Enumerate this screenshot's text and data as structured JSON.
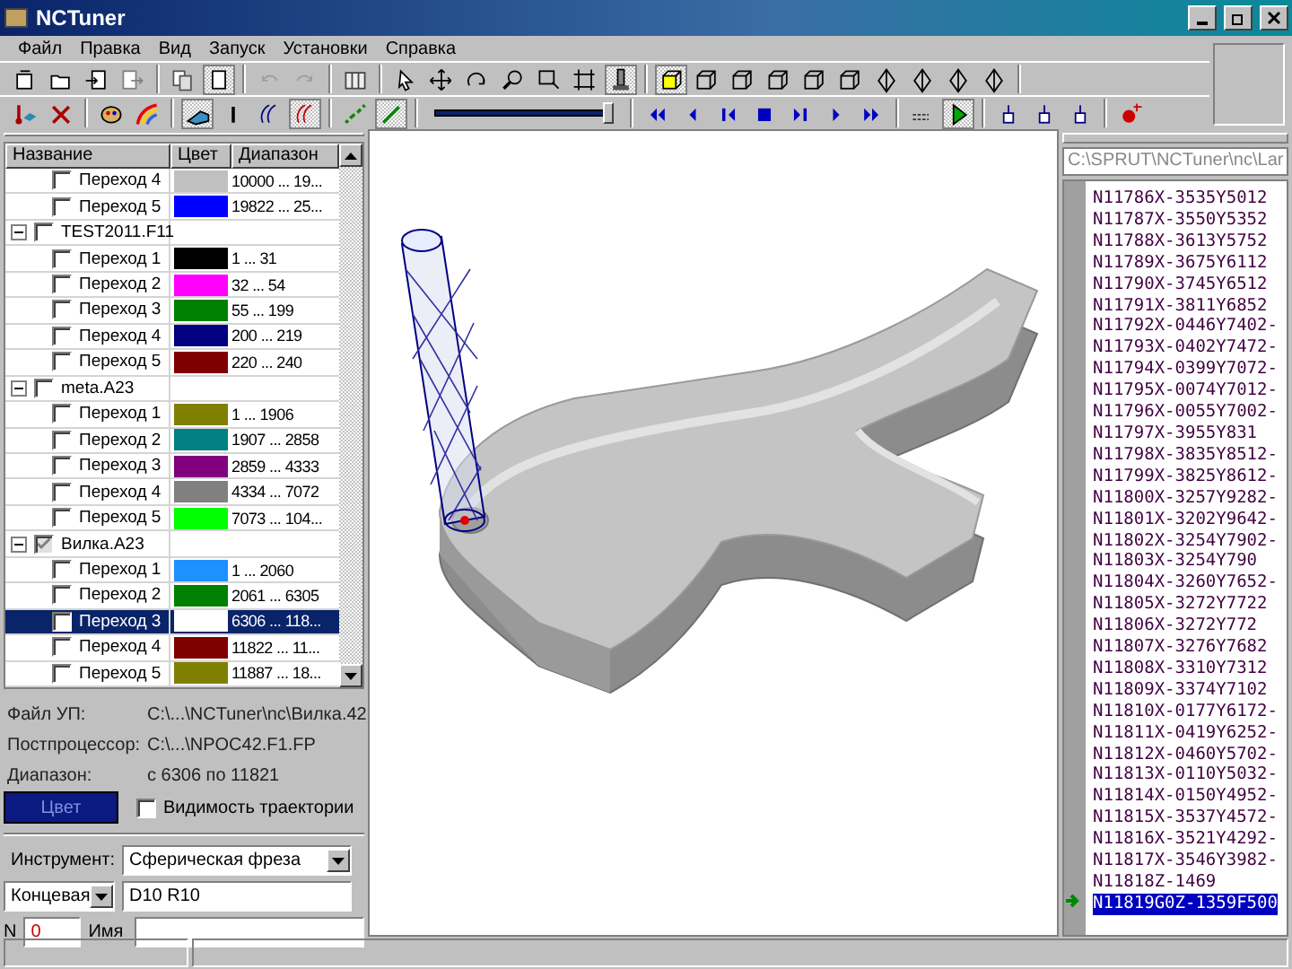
{
  "window": {
    "title": "NCTuner"
  },
  "menu": [
    "Файл",
    "Правка",
    "Вид",
    "Запуск",
    "Установки",
    "Справка"
  ],
  "toolbars": [
    [
      {
        "kind": "doc",
        "pressed": false,
        "disabled": false
      },
      {
        "kind": "folder",
        "pressed": false,
        "disabled": false
      },
      {
        "kind": "import",
        "pressed": false,
        "disabled": false
      },
      {
        "kind": "export",
        "pressed": false,
        "disabled": false
      },
      {
        "kind": "sep"
      },
      {
        "kind": "copy",
        "pressed": false,
        "disabled": false
      },
      {
        "kind": "page",
        "pressed": true,
        "disabled": false
      },
      {
        "kind": "sep"
      },
      {
        "kind": "undo",
        "pressed": false,
        "disabled": true
      },
      {
        "kind": "redo",
        "pressed": false,
        "disabled": true
      },
      {
        "kind": "sep"
      },
      {
        "kind": "grid",
        "pressed": false,
        "disabled": false
      },
      {
        "kind": "sep"
      },
      {
        "kind": "cursor",
        "pressed": false,
        "disabled": false
      },
      {
        "kind": "move",
        "pressed": false,
        "disabled": false
      },
      {
        "kind": "rotate",
        "pressed": false,
        "disabled": false
      },
      {
        "kind": "zoom",
        "pressed": false,
        "disabled": false
      },
      {
        "kind": "zoomrect",
        "pressed": false,
        "disabled": false
      },
      {
        "kind": "fit",
        "pressed": false,
        "disabled": false
      },
      {
        "kind": "cutter",
        "pressed": true,
        "disabled": false
      },
      {
        "kind": "sep"
      },
      {
        "kind": "cubeyellow",
        "pressed": true,
        "disabled": false
      },
      {
        "kind": "cube",
        "pressed": false,
        "disabled": false
      },
      {
        "kind": "cube",
        "pressed": false,
        "disabled": false
      },
      {
        "kind": "cube",
        "pressed": false,
        "disabled": false
      },
      {
        "kind": "cube",
        "pressed": false,
        "disabled": false
      },
      {
        "kind": "cube",
        "pressed": false,
        "disabled": false
      },
      {
        "kind": "diamond",
        "pressed": false,
        "disabled": false
      },
      {
        "kind": "diamond",
        "pressed": false,
        "disabled": false
      },
      {
        "kind": "diamond",
        "pressed": false,
        "disabled": false
      },
      {
        "kind": "diamond",
        "pressed": false,
        "disabled": false
      },
      {
        "kind": "sep"
      }
    ],
    [
      {
        "kind": "thermo",
        "pressed": false,
        "disabled": false
      },
      {
        "kind": "cross",
        "pressed": false,
        "disabled": false
      },
      {
        "kind": "sep"
      },
      {
        "kind": "palette",
        "pressed": false,
        "disabled": false
      },
      {
        "kind": "rainbow",
        "pressed": false,
        "disabled": false
      },
      {
        "kind": "sep"
      },
      {
        "kind": "solid",
        "pressed": true,
        "disabled": false
      },
      {
        "kind": "bar",
        "pressed": false,
        "disabled": false
      },
      {
        "kind": "wave",
        "pressed": false,
        "disabled": false
      },
      {
        "kind": "wavered",
        "pressed": true,
        "disabled": false
      },
      {
        "kind": "sep"
      },
      {
        "kind": "arrows",
        "pressed": false,
        "disabled": false
      },
      {
        "kind": "pencil",
        "pressed": true,
        "disabled": false
      },
      {
        "kind": "sep"
      },
      {
        "kind": "slider"
      },
      {
        "kind": "sep"
      },
      {
        "kind": "first",
        "pressed": false,
        "disabled": false
      },
      {
        "kind": "prev",
        "pressed": false,
        "disabled": false
      },
      {
        "kind": "stepback",
        "pressed": false,
        "disabled": false
      },
      {
        "kind": "stop",
        "pressed": false,
        "disabled": false
      },
      {
        "kind": "stepfwd",
        "pressed": false,
        "disabled": false
      },
      {
        "kind": "play",
        "pressed": false,
        "disabled": false
      },
      {
        "kind": "last",
        "pressed": false,
        "disabled": false
      },
      {
        "kind": "sep"
      },
      {
        "kind": "loop",
        "pressed": false,
        "disabled": false
      },
      {
        "kind": "run",
        "pressed": true,
        "disabled": false
      },
      {
        "kind": "sep"
      },
      {
        "kind": "mark",
        "pressed": false,
        "disabled": false
      },
      {
        "kind": "mark",
        "pressed": false,
        "disabled": false
      },
      {
        "kind": "mark",
        "pressed": false,
        "disabled": false
      },
      {
        "kind": "sep"
      },
      {
        "kind": "redpoint",
        "pressed": false,
        "disabled": false
      }
    ]
  ],
  "slider": {
    "level": 1
  },
  "tree": {
    "columns": [
      "Название",
      "Цвет",
      "Диапазон"
    ],
    "items": [
      {
        "kind": "step",
        "label": "Переход 4",
        "checked": false,
        "color": "#c0c0c0",
        "range": "10000 ... 19...",
        "selected": false
      },
      {
        "kind": "step",
        "label": "Переход 5",
        "checked": false,
        "color": "#0000ff",
        "range": "19822 ... 25...",
        "selected": false
      },
      {
        "kind": "group",
        "label": "TEST2011.F11",
        "checked": false,
        "expanded": true,
        "children": [
          {
            "kind": "step",
            "label": "Переход 1",
            "checked": false,
            "color": "#000000",
            "range": "1 ... 31",
            "selected": false
          },
          {
            "kind": "step",
            "label": "Переход 2",
            "checked": false,
            "color": "#ff00ff",
            "range": "32 ... 54",
            "selected": false
          },
          {
            "kind": "step",
            "label": "Переход 3",
            "checked": false,
            "color": "#008000",
            "range": "55 ... 199",
            "selected": false
          },
          {
            "kind": "step",
            "label": "Переход 4",
            "checked": false,
            "color": "#000080",
            "range": "200 ... 219",
            "selected": false
          },
          {
            "kind": "step",
            "label": "Переход 5",
            "checked": false,
            "color": "#800000",
            "range": "220 ... 240",
            "selected": false
          }
        ]
      },
      {
        "kind": "group",
        "label": "meta.A23",
        "checked": false,
        "expanded": true,
        "children": [
          {
            "kind": "step",
            "label": "Переход 1",
            "checked": false,
            "color": "#808000",
            "range": "1 ... 1906",
            "selected": false
          },
          {
            "kind": "step",
            "label": "Переход 2",
            "checked": false,
            "color": "#008080",
            "range": "1907 ... 2858",
            "selected": false
          },
          {
            "kind": "step",
            "label": "Переход 3",
            "checked": false,
            "color": "#800080",
            "range": "2859 ... 4333",
            "selected": false
          },
          {
            "kind": "step",
            "label": "Переход 4",
            "checked": false,
            "color": "#808080",
            "range": "4334 ... 7072",
            "selected": false
          },
          {
            "kind": "step",
            "label": "Переход 5",
            "checked": false,
            "color": "#00ff00",
            "range": "7073 ... 104...",
            "selected": false
          }
        ]
      },
      {
        "kind": "group",
        "label": "Вилка.A23",
        "checked": true,
        "expanded": true,
        "children": [
          {
            "kind": "step",
            "label": "Переход 1",
            "checked": false,
            "color": "#1e90ff",
            "range": "1 ... 2060",
            "selected": false
          },
          {
            "kind": "step",
            "label": "Переход 2",
            "checked": false,
            "color": "#008000",
            "range": "2061 ... 6305",
            "selected": false
          },
          {
            "kind": "step",
            "label": "Переход 3",
            "checked": false,
            "color": "#ffffff",
            "range": "6306 ... 118...",
            "selected": true
          },
          {
            "kind": "step",
            "label": "Переход 4",
            "checked": false,
            "color": "#800000",
            "range": "11822 ... 11...",
            "selected": false
          },
          {
            "kind": "step",
            "label": "Переход 5",
            "checked": false,
            "color": "#808000",
            "range": "11887 ... 18...",
            "selected": false
          }
        ]
      }
    ]
  },
  "info": [
    {
      "label": "Файл УП:",
      "value": "C:\\...\\NCTuner\\nc\\Вилка.42"
    },
    {
      "label": "Постпроцессор:",
      "value": "C:\\...\\NPOC42.F1.FP"
    },
    {
      "label": "Диапазон:",
      "value": "с 6306 по 11821"
    }
  ],
  "color_button": {
    "label": "Цвет"
  },
  "trajectory": {
    "label": "Видимость траектории",
    "checked": false
  },
  "tool": {
    "label": "Инструмент:",
    "type": "Сферическая фреза",
    "shape": "Концевая",
    "size": "D10 R10",
    "n_label": "N",
    "n": "0",
    "name_label": "Имя"
  },
  "code": {
    "path": "C:\\SPRUT\\NCTuner\\nc\\Lar",
    "lines": [
      {
        "text": "N11786X-3535Y5012",
        "selected": false,
        "current": false
      },
      {
        "text": "N11787X-3550Y5352",
        "selected": false,
        "current": false
      },
      {
        "text": "N11788X-3613Y5752",
        "selected": false,
        "current": false
      },
      {
        "text": "N11789X-3675Y6112",
        "selected": false,
        "current": false
      },
      {
        "text": "N11790X-3745Y6512",
        "selected": false,
        "current": false
      },
      {
        "text": "N11791X-3811Y6852",
        "selected": false,
        "current": false
      },
      {
        "text": "N11792X-0446Y7402-",
        "selected": false,
        "current": false
      },
      {
        "text": "N11793X-0402Y7472-",
        "selected": false,
        "current": false
      },
      {
        "text": "N11794X-0399Y7072-",
        "selected": false,
        "current": false
      },
      {
        "text": "N11795X-0074Y7012-",
        "selected": false,
        "current": false
      },
      {
        "text": "N11796X-0055Y7002-",
        "selected": false,
        "current": false
      },
      {
        "text": "N11797X-3955Y831",
        "selected": false,
        "current": false
      },
      {
        "text": "N11798X-3835Y8512-",
        "selected": false,
        "current": false
      },
      {
        "text": "N11799X-3825Y8612-",
        "selected": false,
        "current": false
      },
      {
        "text": "N11800X-3257Y9282-",
        "selected": false,
        "current": false
      },
      {
        "text": "N11801X-3202Y9642-",
        "selected": false,
        "current": false
      },
      {
        "text": "N11802X-3254Y7902-",
        "selected": false,
        "current": false
      },
      {
        "text": "N11803X-3254Y790",
        "selected": false,
        "current": false
      },
      {
        "text": "N11804X-3260Y7652-",
        "selected": false,
        "current": false
      },
      {
        "text": "N11805X-3272Y7722",
        "selected": false,
        "current": false
      },
      {
        "text": "N11806X-3272Y772",
        "selected": false,
        "current": false
      },
      {
        "text": "N11807X-3276Y7682",
        "selected": false,
        "current": false
      },
      {
        "text": "N11808X-3310Y7312",
        "selected": false,
        "current": false
      },
      {
        "text": "N11809X-3374Y7102",
        "selected": false,
        "current": false
      },
      {
        "text": "N11810X-0177Y6172-",
        "selected": false,
        "current": false
      },
      {
        "text": "N11811X-0419Y6252-",
        "selected": false,
        "current": false
      },
      {
        "text": "N11812X-0460Y5702-",
        "selected": false,
        "current": false
      },
      {
        "text": "N11813X-0110Y5032-",
        "selected": false,
        "current": false
      },
      {
        "text": "N11814X-0150Y4952-",
        "selected": false,
        "current": false
      },
      {
        "text": "N11815X-3537Y4572-",
        "selected": false,
        "current": false
      },
      {
        "text": "N11816X-3521Y4292-",
        "selected": false,
        "current": false
      },
      {
        "text": "N11817X-3546Y3982-",
        "selected": false,
        "current": false
      },
      {
        "text": "N11818Z-1469",
        "selected": false,
        "current": false
      },
      {
        "text": "N11819G0Z-1359F500",
        "selected": true,
        "current": true
      }
    ]
  }
}
